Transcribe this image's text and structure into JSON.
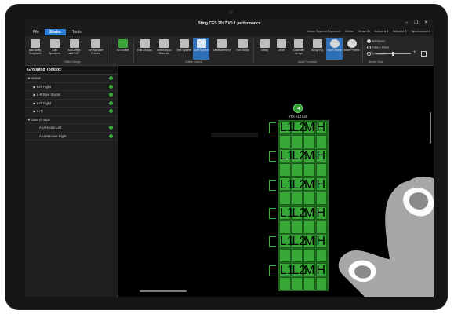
{
  "window": {
    "title": "Sting CES 2017 V0.1.performance",
    "controls": "–  ❐  ✕"
  },
  "menu": {
    "items": [
      {
        "label": "File",
        "active": false
      },
      {
        "label": "Shake",
        "active": true
      },
      {
        "label": "Tools",
        "active": false
      }
    ]
  },
  "status": {
    "engineer": "Venue Systems Engineer1",
    "online": "Online",
    "venue": "Venue 36",
    "detected": "Detected 3",
    "watched": "Watched 3",
    "synchronized": "Synchronized 0"
  },
  "ribbon": {
    "buttons": [
      {
        "label": "Add Array Templates"
      },
      {
        "label": "Add Speakers"
      },
      {
        "label": "Add Amps and DSP"
      },
      {
        "label": "Set Speaker Presets"
      },
      {
        "label": "Go Online"
      },
      {
        "label": "Edit Groups"
      },
      {
        "label": "Select Input Sources"
      },
      {
        "label": "Test System"
      },
      {
        "label": "Tune System"
      },
      {
        "label": "Measurement"
      },
      {
        "label": "Run Show"
      },
      {
        "label": "Delay"
      },
      {
        "label": "Level"
      },
      {
        "label": "Calibrate Arrays"
      },
      {
        "label": "Group EQ"
      },
      {
        "label": "Mute Matrix"
      },
      {
        "label": "Mute Protect"
      }
    ],
    "groups": {
      "offline": "Offline Design",
      "online": "Online Control",
      "mode": "Mode Functions",
      "device": "Device View"
    },
    "view_options": [
      {
        "label": "Bandpass",
        "selected": true
      },
      {
        "label": "Device Panel",
        "selected": false
      },
      {
        "label": "Orientation",
        "selected": false
      }
    ]
  },
  "sidebar": {
    "title": "Grouping Toolbox",
    "rows": [
      {
        "label": "Venue",
        "indent": 0,
        "expanded": true
      },
      {
        "label": "Left Right",
        "indent": 1,
        "expanded": false
      },
      {
        "label": "L-R Row Stacks",
        "indent": 1,
        "expanded": false
      },
      {
        "label": "Left Right",
        "indent": 1,
        "expanded": false
      },
      {
        "label": "L+R",
        "indent": 1,
        "expanded": false
      },
      {
        "label": "User Groups",
        "indent": 0,
        "expanded": true
      },
      {
        "label": "A U-House Left",
        "indent": 2,
        "expanded": null
      },
      {
        "label": "A U-inHouse Right",
        "indent": 2,
        "expanded": null
      }
    ]
  },
  "canvas": {
    "array_label": "VTX A12 Left",
    "cabinet_labels": [
      "L1",
      "L2",
      "M",
      "H"
    ],
    "cabinets": 12
  },
  "colors": {
    "accent": "#2e7fd8",
    "online_green": "#3fae3f",
    "cabinet_green": "#37a737"
  }
}
